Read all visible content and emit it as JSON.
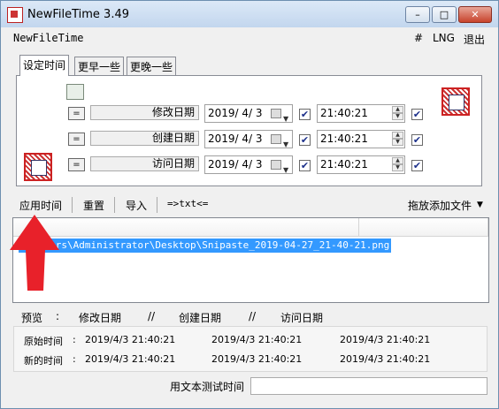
{
  "window": {
    "title": "NewFileTime 3.49"
  },
  "controls": {
    "minimize": "–",
    "maximize": "□",
    "close": "✕"
  },
  "menu": {
    "app_name": "NewFileTime",
    "hash": "#",
    "lng": "LNG",
    "exit": "退出"
  },
  "tabs": [
    {
      "label": "设定时间",
      "active": true
    },
    {
      "label": "更早一些",
      "active": false
    },
    {
      "label": "更晚一些",
      "active": false
    }
  ],
  "rows": [
    {
      "eq": "=",
      "label": "修改日期",
      "date": "2019/ 4/ 3",
      "date_checked": true,
      "time": "21:40:21",
      "time_checked": true
    },
    {
      "eq": "=",
      "label": "创建日期",
      "date": "2019/ 4/ 3",
      "date_checked": true,
      "time": "21:40:21",
      "time_checked": true
    },
    {
      "eq": "=",
      "label": "访问日期",
      "date": "2019/ 4/ 3",
      "date_checked": true,
      "time": "21:40:21",
      "time_checked": true
    }
  ],
  "toolbar": {
    "apply": "应用时间",
    "reset": "重置",
    "import": "导入",
    "txt": "=>txt<=",
    "drag": "拖放添加文件"
  },
  "filelist": {
    "path": "C:\\Users\\Administrator\\Desktop\\Snipaste_2019-04-27_21-40-21.png"
  },
  "preview": {
    "header": {
      "label": "预览",
      "sep1": ":",
      "col1": "修改日期",
      "sep2": "//",
      "col2": "创建日期",
      "sep3": "//",
      "col3": "访问日期"
    },
    "original": {
      "label": "原始时间",
      "sep": ":",
      "modified": "2019/4/3 21:40:21",
      "created": "2019/4/3 21:40:21",
      "accessed": "2019/4/3 21:40:21"
    },
    "new": {
      "label": "新的时间",
      "sep": ":",
      "modified": "2019/4/3 21:40:21",
      "created": "2019/4/3 21:40:21",
      "accessed": "2019/4/3 21:40:21"
    }
  },
  "test_label": "用文本测试时间",
  "colors": {
    "selection": "#3399ff",
    "arrow": "#e8212a"
  }
}
